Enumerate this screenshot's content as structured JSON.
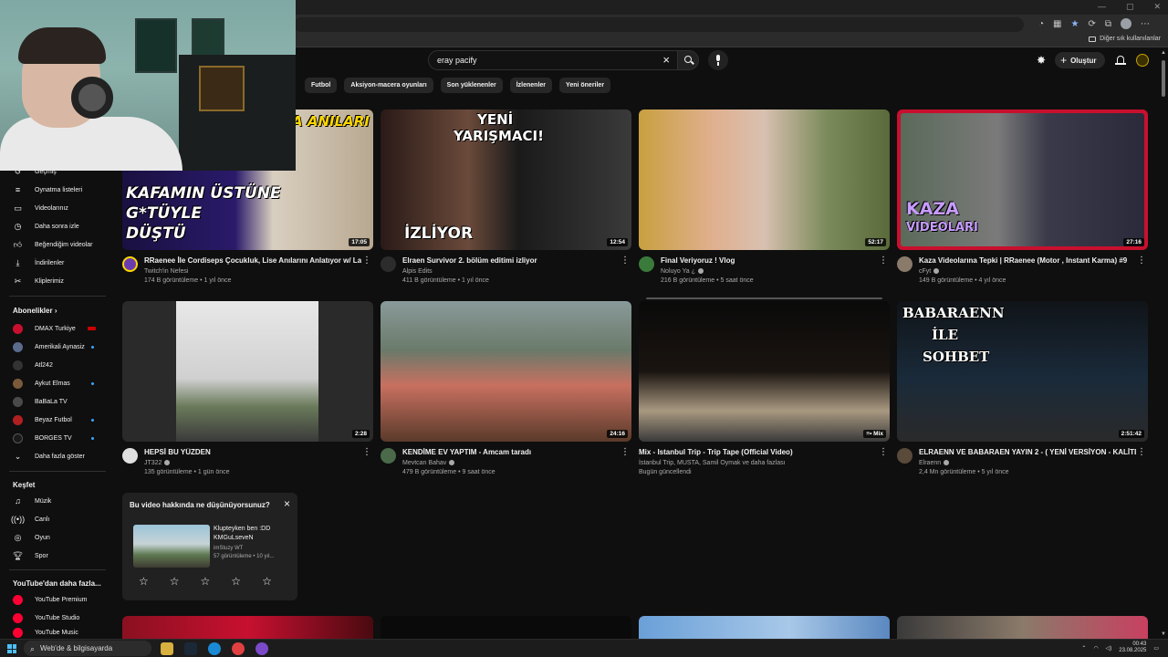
{
  "browser": {
    "bookmarks_other": "Diğer sık kullanılanlar"
  },
  "search": {
    "query": "eray pacify"
  },
  "header": {
    "create_label": "Oluştur"
  },
  "chips": [
    "Futbol",
    "Aksiyon-macera oyunları",
    "Son yüklenenler",
    "İzlenenler",
    "Yeni öneriler"
  ],
  "sidebar": {
    "items": [
      {
        "label": "Geçmiş",
        "icon": "history-icon"
      },
      {
        "label": "Oynatma listeleri",
        "icon": "playlist-icon"
      },
      {
        "label": "Videolarınız",
        "icon": "your-videos-icon"
      },
      {
        "label": "Daha sonra izle",
        "icon": "watch-later-icon"
      },
      {
        "label": "Beğendiğim videolar",
        "icon": "liked-icon"
      },
      {
        "label": "İndirilenler",
        "icon": "download-icon"
      },
      {
        "label": "Kliplerimiz",
        "icon": "clips-icon"
      }
    ],
    "subs_heading": "Abonelikler",
    "subs": [
      {
        "label": "DMAX Turkiye",
        "color": "#c8102e",
        "live": true
      },
      {
        "label": "Amerikali Aynasiz",
        "color": "#5a6b8c",
        "dot": true
      },
      {
        "label": "Atl242",
        "color": "#333333"
      },
      {
        "label": "Aykut Elmas",
        "color": "#7a5a3a",
        "dot": true
      },
      {
        "label": "BaBaLa TV",
        "color": "#4a4a4a"
      },
      {
        "label": "Beyaz Futbol",
        "color": "#b02020",
        "dot": true
      },
      {
        "label": "BORGES TV",
        "color": "#1a1a1a",
        "dot": true
      }
    ],
    "show_more": "Daha fazla göster",
    "explore_heading": "Keşfet",
    "explore": [
      {
        "label": "Müzik",
        "icon": "music-icon"
      },
      {
        "label": "Canlı",
        "icon": "live-icon"
      },
      {
        "label": "Oyun",
        "icon": "gaming-icon"
      },
      {
        "label": "Spor",
        "icon": "sports-icon"
      }
    ],
    "more_heading": "YouTube'dan daha fazla...",
    "more": [
      {
        "label": "YouTube Premium"
      },
      {
        "label": "YouTube Studio"
      },
      {
        "label": "YouTube Music"
      }
    ]
  },
  "videos": [
    {
      "title": "RRaenee İle Cordiseps Çocukluk, Lise Anılarını Anlatıyor w/ Lazona",
      "channel": "Twitch'in Nefesi",
      "stats": "174 B görüntüleme • 1 yıl önce",
      "duration": "17:05",
      "thumb_text_1": "A ANILARI",
      "thumb_text_2": "KAFAMIN ÜSTÜNE",
      "thumb_text_3": "G*TÜYLE",
      "thumb_text_4": "DÜŞTÜ",
      "avatar_color": "#6a3cb0"
    },
    {
      "title": "Elraen Survivor 2. bölüm editimi izliyor",
      "channel": "Alpis Edits",
      "stats": "411 B görüntüleme • 1 yıl önce",
      "duration": "12:54",
      "thumb_text_1": "YENİ",
      "thumb_text_2": "YARIŞMACI!",
      "thumb_text_3": "İZLİYOR",
      "avatar_color": "#2c2c2c"
    },
    {
      "title": "Final Veriyoruz ! Vlog",
      "channel": "Noluyo Ya ¿",
      "stats": "216 B görüntüleme • 5 saat önce",
      "duration": "52:17",
      "verified": true,
      "avatar_color": "#3a7a3a"
    },
    {
      "title": "Kaza Videolarına Tepki | RRaenee (Motor , Instant Karma) #9",
      "channel": "cFyt",
      "stats": "149 B görüntüleme • 4 yıl önce",
      "duration": "27:16",
      "thumb_text_1": "KAZA",
      "thumb_text_2": "VIDEOLARI",
      "verified": true,
      "avatar_color": "#8a7a6a"
    },
    {
      "title": "HEPSİ BU YÜZDEN",
      "channel": "JT322",
      "stats": "135 görüntüleme • 1 gün önce",
      "duration": "2:28",
      "verified": true,
      "avatar_color": "#e0e0e0"
    },
    {
      "title": "KENDİME EV YAPTIM - Amcam taradı",
      "channel": "Mevtcan Bahav",
      "stats": "479 B görüntüleme • 9 saat önce",
      "duration": "24:16",
      "verified": true,
      "avatar_color": "#4a6a4a"
    },
    {
      "title": "Mix - Istanbul Trip - Trip Tape (Official Video)",
      "channel": "İstanbul Trip, MUSTA, Samil Oymak ve daha fazlası",
      "stats": "Bugün güncellendi",
      "duration": "Mix"
    },
    {
      "title": "ELRAENN VE BABARAEN YAYIN 2 - ( YENİ VERSİYON - KALİTELİ )",
      "channel": "Elraenn",
      "stats": "2,4 Mn görüntüleme • 5 yıl önce",
      "duration": "2:51:42",
      "thumb_text_1": "BABARAENN",
      "thumb_text_2": "İLE",
      "thumb_text_3": "SOHBET",
      "verified": true,
      "avatar_color": "#5a4a3a"
    }
  ],
  "survey": {
    "title": "Bu video hakkında ne düşünüyorsunuz?",
    "video_title_1": "Klupteyken ben :DD",
    "video_title_2": "KMGuLsevеN",
    "channel": "imStuzy WT",
    "stats": "57 görüntüleme • 10 yıl..."
  },
  "taskbar": {
    "search_text": "Web'de & bilgisayarda",
    "time": "00:43",
    "date": "23.08.2025"
  }
}
